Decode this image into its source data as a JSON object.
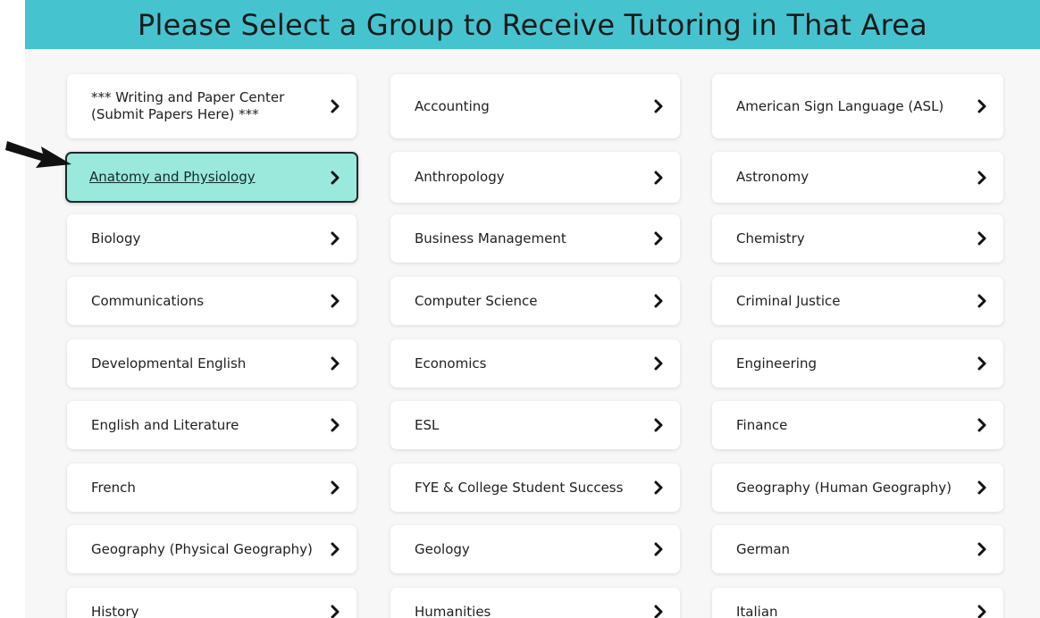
{
  "banner": {
    "title": "Please Select a Group to Receive Tutoring in That Area",
    "color": "#45c4d0"
  },
  "highlight_color": "#9be9dc",
  "groups": [
    [
      "*** Writing and Paper Center\n(Submit Papers Here) ***",
      "Accounting",
      "American Sign Language (ASL)"
    ],
    [
      "Anatomy and Physiology",
      "Anthropology",
      "Astronomy"
    ],
    [
      "Biology",
      "Business Management",
      "Chemistry"
    ],
    [
      "Communications",
      "Computer Science",
      "Criminal Justice"
    ],
    [
      "Developmental English",
      "Economics",
      "Engineering"
    ],
    [
      "English and Literature",
      "ESL",
      "Finance"
    ],
    [
      "French",
      "FYE & College Student Success",
      "Geography (Human Geography)"
    ],
    [
      "Geography (Physical Geography)",
      "Geology",
      "German"
    ],
    [
      "History",
      "Humanities",
      "Italian"
    ]
  ],
  "selected": "Anatomy and Physiology",
  "icons": {
    "card_chevron": "chevron-right-icon",
    "pointer": "arrow-pointer-icon"
  }
}
